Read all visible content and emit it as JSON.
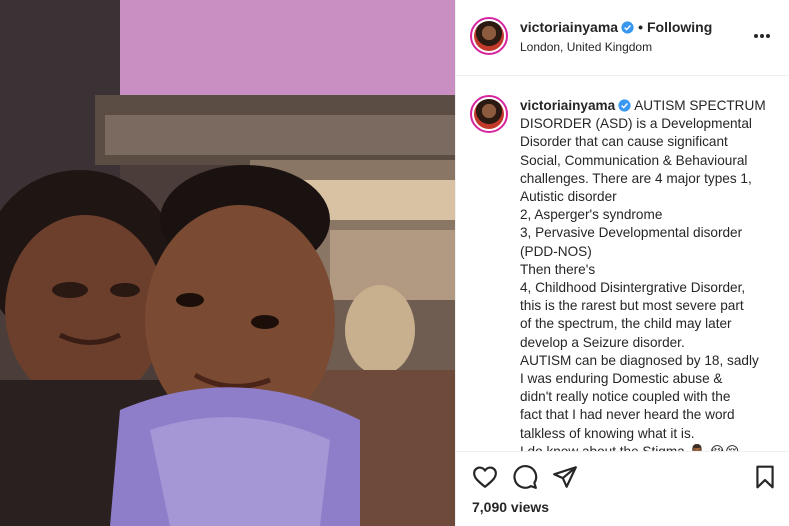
{
  "post": {
    "username": "victoriainyama",
    "separator": "•",
    "follow_label": "Following",
    "location": "London, United Kingdom",
    "more_label": "•••",
    "caption_lines": [
      "AUTISM SPECTRUM",
      "DISORDER (ASD) is a Developmental",
      "Disorder that can cause significant",
      "Social, Communication & Behavioural",
      "challenges. There are 4 major types 1,",
      "Autistic disorder",
      "2, Asperger's syndrome",
      "3, Pervasive Developmental disorder",
      "(PDD-NOS)",
      "Then there's",
      "4, Childhood Disintergrative Disorder,",
      "this is the rarest but most severe part",
      "of the spectrum, the child may later",
      "develop a Seizure disorder.",
      "AUTISM can be diagnosed by 18, sadly",
      "I was enduring Domestic abuse &",
      "didn't really notice coupled with the",
      "fact that I had never heard the word",
      "talkless of knowing what it is.",
      "I do know about the Stigma 🤦🏾‍♂️ 😭😔"
    ],
    "views": "7,090 views"
  },
  "icons": {
    "verified": "verified-badge-icon",
    "like": "heart-icon",
    "comment": "comment-bubble-icon",
    "share": "paper-plane-icon",
    "save": "bookmark-icon"
  },
  "colors": {
    "verified": "#3897f0",
    "avatar_ring": "#d6249f",
    "divider": "#efefef",
    "text": "#262626"
  }
}
